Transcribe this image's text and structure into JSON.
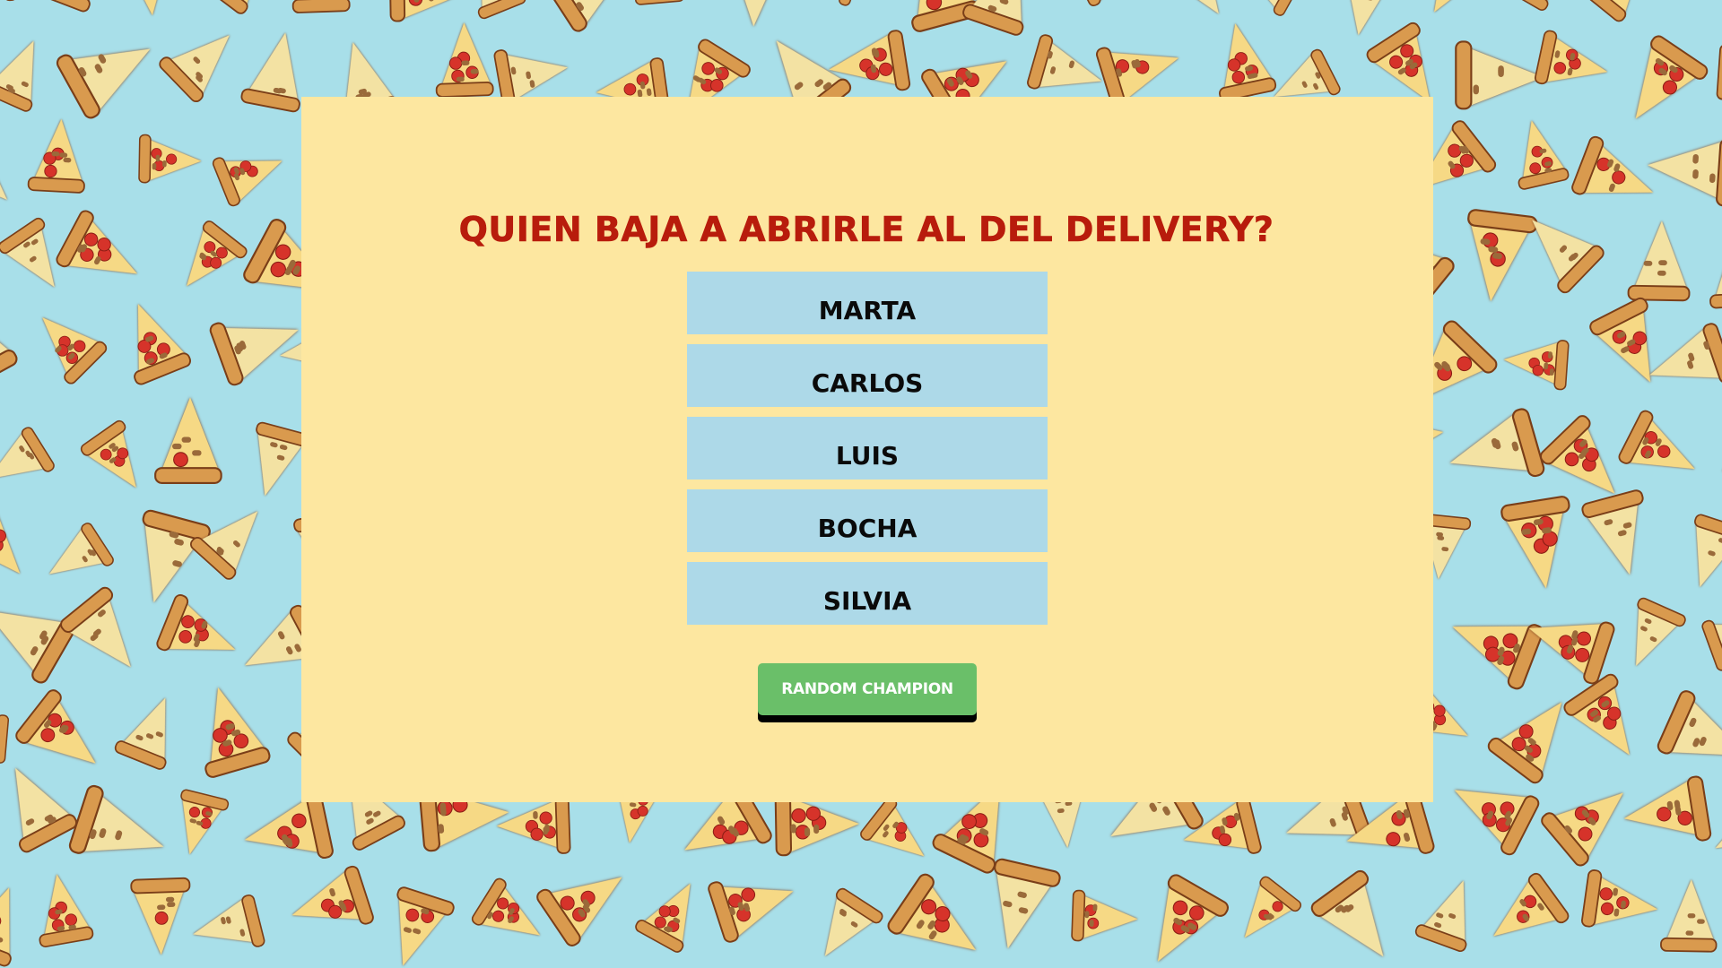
{
  "page": {
    "background_color": "#a8dfe9",
    "background_pattern": "pizza-slices"
  },
  "card": {
    "background_color": "#fde7a0",
    "title": "QUIEN BAJA A ABRIRLE AL DEL DELIVERY?",
    "title_color": "#b81c0c"
  },
  "names": [
    {
      "label": "MARTA"
    },
    {
      "label": "CARLOS"
    },
    {
      "label": "LUIS"
    },
    {
      "label": "BOCHA"
    },
    {
      "label": "SILVIA"
    }
  ],
  "random_button": {
    "label": "RANDOM CHAMPION",
    "color": "#6abf69"
  }
}
